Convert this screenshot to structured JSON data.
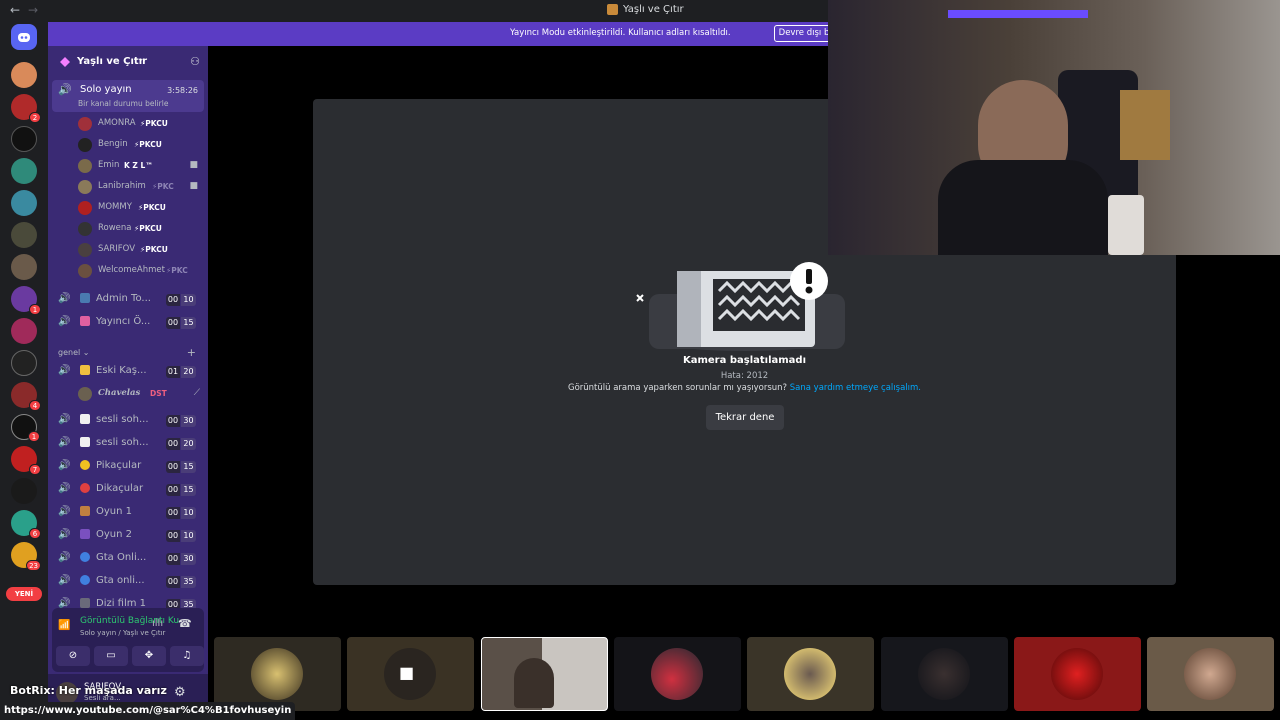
{
  "titlebar": {
    "title": "Yaşlı ve Çıtır",
    "back": "←",
    "forward": "→"
  },
  "banner": {
    "message": "Yayıncı Modu etkinleştirildi. Kullanıcı adları kısaltıldı.",
    "disable_button": "Devre dışı bırak"
  },
  "rail": {
    "new_label": "YENİ",
    "badges": [
      "2",
      "1",
      "4",
      "1",
      "7",
      "6",
      "23"
    ]
  },
  "guild": {
    "name": "Yaşlı ve Çıtır"
  },
  "active_channel": {
    "name": "Solo yayın",
    "timer": "3:58:26",
    "status_hint": "Bir kanal durumu belirle"
  },
  "members": [
    {
      "name": "AMONRA",
      "tag": "⚡PKCU"
    },
    {
      "name": "Bengin",
      "tag": "⚡PKCU"
    },
    {
      "name": "Emin",
      "tag": "K Z L™"
    },
    {
      "name": "Lanibrahim",
      "tag": "⚡PKC"
    },
    {
      "name": "MOMMY",
      "tag": "⚡PKCU"
    },
    {
      "name": "Rowena",
      "tag": "⚡PKCU"
    },
    {
      "name": "SARIFOV",
      "tag": "⚡PKCU"
    },
    {
      "name": "WelcomeAhmet",
      "tag": "⚡PKC"
    }
  ],
  "top_channels": [
    {
      "name": "Admin To...",
      "a": "00",
      "b": "10"
    },
    {
      "name": "Yayıncı Ö...",
      "a": "00",
      "b": "15"
    }
  ],
  "category": {
    "name": "genel"
  },
  "eski": {
    "name": "Eski Kaş...",
    "a": "01",
    "b": "20",
    "member": "Chavelas",
    "member_tag": "DST"
  },
  "channels": [
    {
      "name": "sesli soh...",
      "a": "00",
      "b": "30"
    },
    {
      "name": "sesli soh...",
      "a": "00",
      "b": "20"
    },
    {
      "name": "Pikaçular",
      "a": "00",
      "b": "15"
    },
    {
      "name": "Dikaçular",
      "a": "00",
      "b": "15"
    },
    {
      "name": "Oyun 1",
      "a": "00",
      "b": "10"
    },
    {
      "name": "Oyun 2",
      "a": "00",
      "b": "10"
    },
    {
      "name": "Gta Onli...",
      "a": "00",
      "b": "30"
    },
    {
      "name": "Gta onli...",
      "a": "00",
      "b": "35"
    },
    {
      "name": "Dizi film 1",
      "a": "00",
      "b": "35"
    }
  ],
  "voice_panel": {
    "title": "Görüntülü Bağlantı Ku",
    "subtitle": "Solo yayın / Yaşlı ve Çıtır"
  },
  "user_panel": {
    "name": "SARIFOV",
    "status": "Sesli ara..."
  },
  "error": {
    "title": "Kamera başlatılamadı",
    "code": "Hata: 2012",
    "help_text": "Görüntülü arama yaparken sorunlar mı yaşıyorsun?",
    "help_link": "Sana yardım etmeye çalışalım.",
    "retry": "Tekrar dene"
  },
  "overlay": {
    "ticker": "BotRix: Her maşada varız",
    "url": "https://www.youtube.com/@sar%C4%B1fovhuseyin"
  },
  "colors": {
    "banner": "#5b3cc4",
    "sidebar": "#3a2a74",
    "connected": "#2dc770",
    "link": "#00a8fc"
  }
}
